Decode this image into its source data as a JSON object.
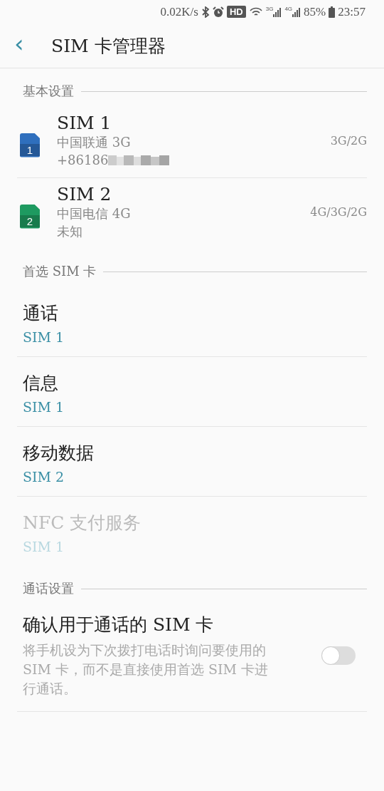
{
  "status_bar": {
    "speed": "0.02K/s",
    "hd": "HD",
    "net1": "3G",
    "net2": "4G",
    "battery": "85%",
    "time": "23:57"
  },
  "header": {
    "back": "‹",
    "title": "SIM 卡管理器"
  },
  "sections": [
    {
      "title": "基本设置",
      "kind": "sims",
      "items": [
        {
          "number": "1",
          "name": "SIM 1",
          "carrier": "中国联通 3G",
          "detail": "+86186",
          "redacted": true,
          "network": "3G/2G",
          "color": "#2f6fbd"
        },
        {
          "number": "2",
          "name": "SIM 2",
          "carrier": "中国电信 4G",
          "detail": "未知",
          "redacted": false,
          "network": "4G/3G/2G",
          "color": "#1e9a60"
        }
      ]
    },
    {
      "title": "首选 SIM 卡",
      "kind": "prefs",
      "items": [
        {
          "label": "通话",
          "value": "SIM 1",
          "disabled": false
        },
        {
          "label": "信息",
          "value": "SIM 1",
          "disabled": false
        },
        {
          "label": "移动数据",
          "value": "SIM 2",
          "disabled": false
        },
        {
          "label": "NFC 支付服务",
          "value": "SIM 1",
          "disabled": true
        }
      ]
    },
    {
      "title": "通话设置",
      "kind": "toggles",
      "items": [
        {
          "label": "确认用于通话的 SIM 卡",
          "description": "将手机设为下次拨打电话时询问要使用的 SIM 卡，而不是直接使用首选 SIM 卡进行通话。",
          "on": false
        }
      ]
    }
  ]
}
